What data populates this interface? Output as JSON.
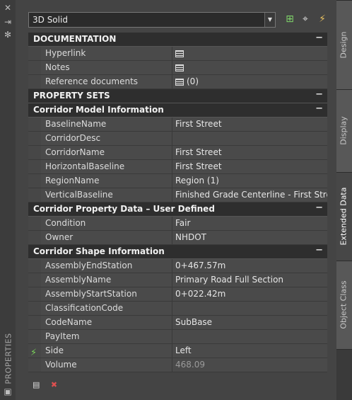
{
  "palette": {
    "title": "PROPERTIES"
  },
  "dropdown": {
    "value": "3D Solid"
  },
  "sections": [
    {
      "title": "DOCUMENTATION",
      "collapse": "−",
      "rows": [
        {
          "key": "Hyperlink",
          "value": "",
          "icon": "table-icon"
        },
        {
          "key": "Notes",
          "value": "",
          "icon": "table-icon"
        },
        {
          "key": "Reference documents",
          "value": "(0)",
          "icon": "table-icon"
        }
      ]
    },
    {
      "title": "PROPERTY SETS",
      "collapse": "−",
      "rows": []
    },
    {
      "title": "Corridor Model Information",
      "collapse": "−",
      "rows": [
        {
          "key": "BaselineName",
          "value": "First Street"
        },
        {
          "key": "CorridorDesc",
          "value": ""
        },
        {
          "key": "CorridorName",
          "value": "First Street"
        },
        {
          "key": "HorizontalBaseline",
          "value": "First Street"
        },
        {
          "key": "RegionName",
          "value": "Region (1)"
        },
        {
          "key": "VerticalBaseline",
          "value": "Finished Grade Centerline - First Street"
        }
      ]
    },
    {
      "title": "Corridor Property Data – User Defined",
      "collapse": "−",
      "rows": [
        {
          "key": "Condition",
          "value": "Fair"
        },
        {
          "key": "Owner",
          "value": "NHDOT"
        }
      ]
    },
    {
      "title": "Corridor Shape Information",
      "collapse": "−",
      "rows": [
        {
          "key": "AssemblyEndStation",
          "value": "0+467.57m"
        },
        {
          "key": "AssemblyName",
          "value": "Primary Road Full Section"
        },
        {
          "key": "AssemblyStartStation",
          "value": "0+022.42m"
        },
        {
          "key": "ClassificationCode",
          "value": ""
        },
        {
          "key": "CodeName",
          "value": "SubBase"
        },
        {
          "key": "PayItem",
          "value": ""
        },
        {
          "key": "Side",
          "value": "Left"
        },
        {
          "key": "Volume",
          "value": "468.09",
          "dim": true
        }
      ]
    }
  ],
  "tabs": [
    {
      "label": "Design",
      "active": false
    },
    {
      "label": "Display",
      "active": false
    },
    {
      "label": "Extended Data",
      "active": true
    },
    {
      "label": "Object Class",
      "active": false
    }
  ],
  "icons": {
    "close": "close-icon",
    "autohide": "autohide-icon",
    "settings": "gear-icon",
    "add_propset": "add-property-set-icon",
    "select": "select-objects-icon",
    "quick_select": "quick-select-icon"
  }
}
